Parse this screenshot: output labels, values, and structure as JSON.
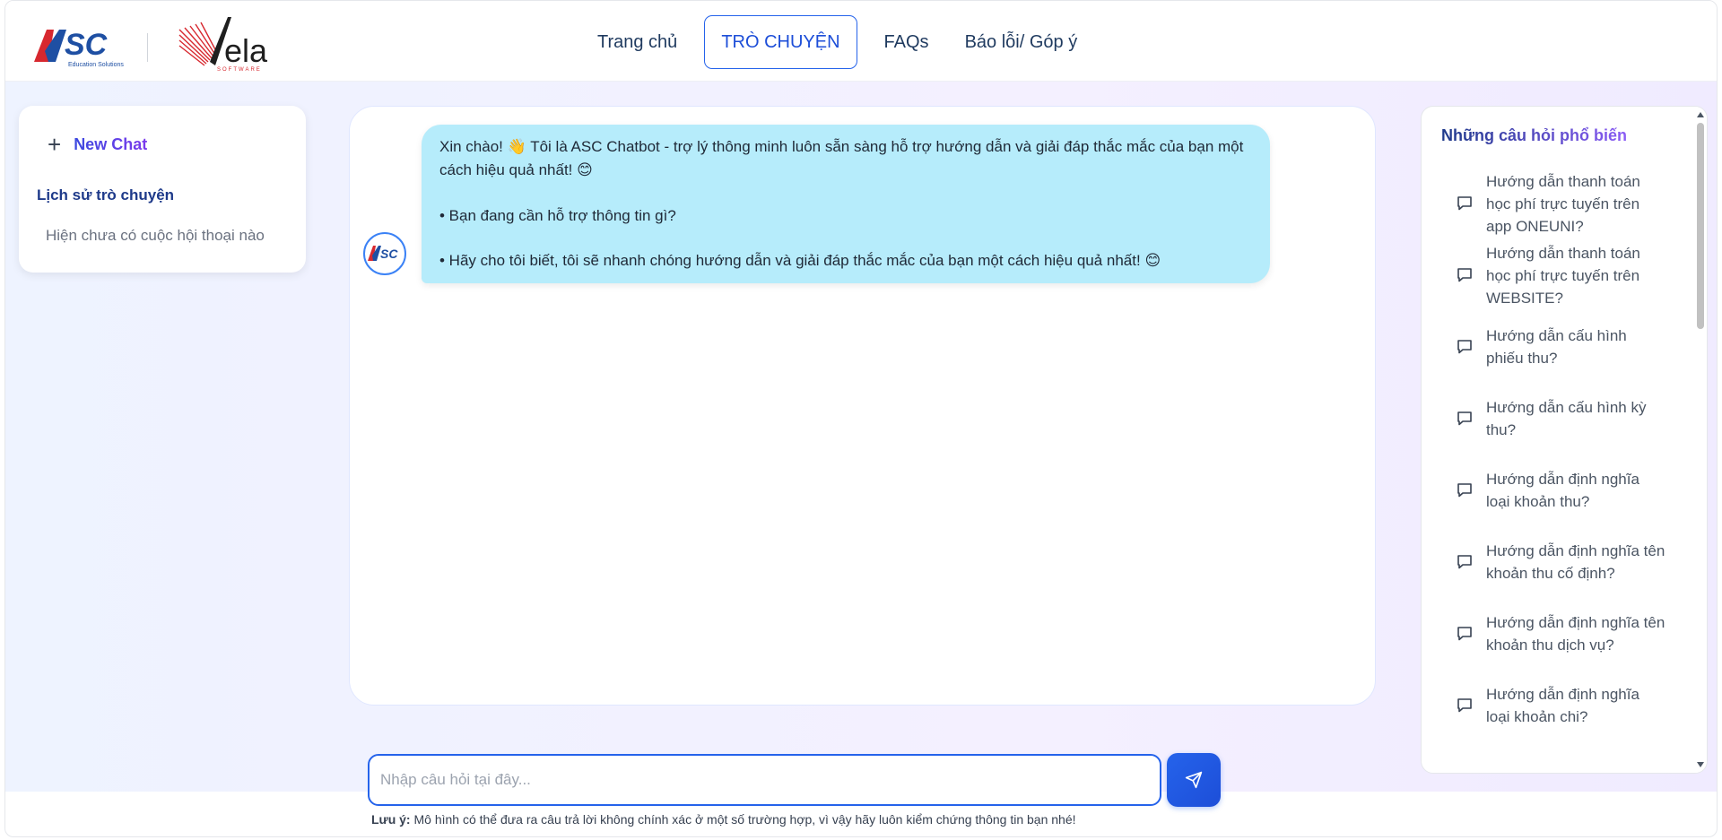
{
  "header": {
    "logo_left": "ASC",
    "logo_left_sub": "Education Solutions",
    "logo_right": "Vela",
    "logo_right_sub": "SOFTWARE",
    "nav": [
      {
        "label": "Trang chủ",
        "active": false
      },
      {
        "label": "TRÒ CHUYỆN",
        "active": true
      },
      {
        "label": "FAQs",
        "active": false
      },
      {
        "label": "Báo lỗi/ Góp ý",
        "active": false
      }
    ]
  },
  "sidebar": {
    "new_chat_label": "New Chat",
    "history_title": "Lịch sử trò chuyện",
    "history_empty": "Hiện chưa có cuộc hội thoại nào"
  },
  "chat": {
    "avatar_text": "ASC",
    "message": {
      "line1_before_emoji": "Xin chào! ",
      "wave_emoji": "👋",
      "line1_after_emoji": " Tôi là ASC Chatbot - trợ lý thông minh luôn sẵn sàng hỗ trợ hướng dẫn và giải đáp thắc mắc của bạn một cách hiệu quả nhất! ",
      "smile_emoji": "😊",
      "line2": "• Bạn đang cần hỗ trợ thông tin gì?",
      "line3": "• Hãy cho tôi biết, tôi sẽ nhanh chóng hướng dẫn và giải đáp thắc mắc của bạn một cách hiệu quả nhất! "
    }
  },
  "faq": {
    "title": "Những câu hỏi phổ biến",
    "items": [
      "Hướng dẫn thanh toán học phí trực tuyến trên app ONEUNI?",
      "Hướng dẫn thanh toán học phí trực tuyến trên WEBSITE?",
      "Hướng dẫn cấu hình phiếu thu?",
      "Hướng dẫn cấu hình kỳ thu?",
      "Hướng dẫn định nghĩa loại khoản thu?",
      "Hướng dẫn định nghĩa tên khoản thu cố định?",
      "Hướng dẫn định nghĩa tên khoản thu dịch vụ?",
      "Hướng dẫn định nghĩa loại khoản chi?"
    ]
  },
  "input": {
    "placeholder": "Nhập câu hỏi tại đây...",
    "value": ""
  },
  "note": {
    "label": "Lưu ý:",
    "text": " Mô hình có thể đưa ra câu trả lời không chính xác ở một số trường hợp, vì vậy hãy luôn kiểm chứng thông tin bạn nhé!"
  },
  "colors": {
    "accent": "#2563eb",
    "bubble": "#b6ecfb",
    "asc_red": "#d7282f",
    "asc_blue": "#1e4fa3"
  }
}
